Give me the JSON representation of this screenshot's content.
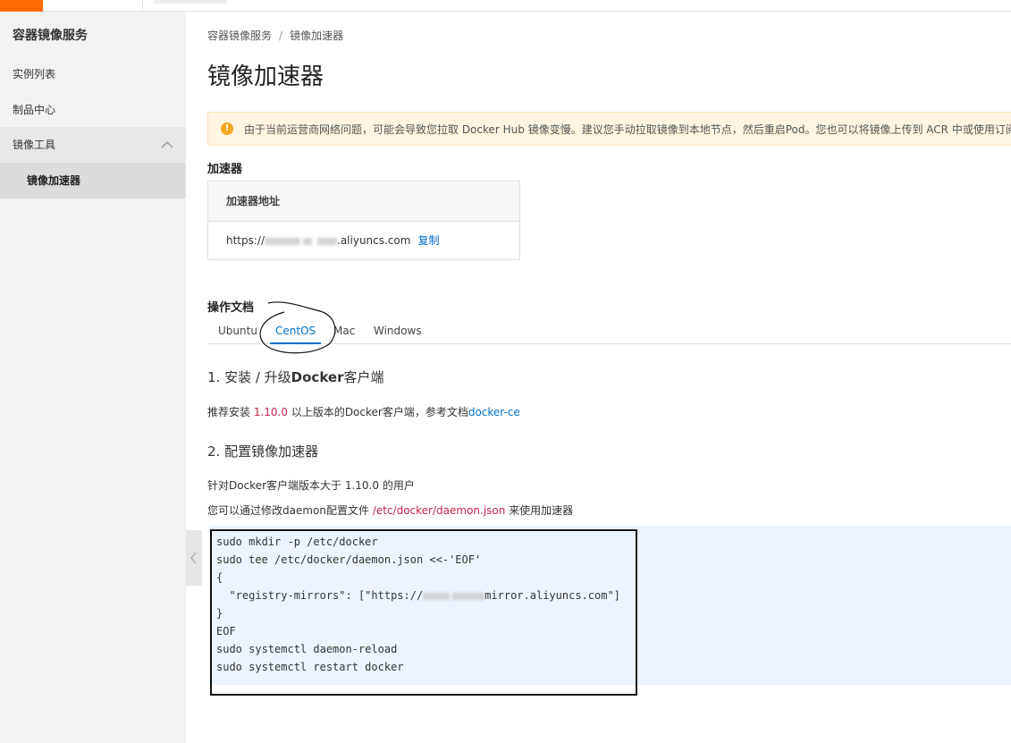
{
  "sidebar": {
    "title": "容器镜像服务",
    "items": [
      {
        "label": "实例列表"
      },
      {
        "label": "制品中心"
      },
      {
        "label": "镜像工具"
      },
      {
        "label": "镜像加速器"
      }
    ]
  },
  "breadcrumb": {
    "root": "容器镜像服务",
    "sep": "/",
    "current": "镜像加速器"
  },
  "page_title": "镜像加速器",
  "alert": {
    "message": "由于当前运营商网络问题，可能会导致您拉取 Docker Hub 镜像变慢。建议您手动拉取镜像到本地节点，然后重启Pod。您也可以将镜像上传到 ACR 中或使用订阅海"
  },
  "accelerator": {
    "section_title": "加速器",
    "column_header": "加速器地址",
    "url_prefix": "https://",
    "url_suffix": ".aliyuncs.com",
    "copy_label": "复制"
  },
  "docs": {
    "section_title": "操作文档",
    "tabs": [
      {
        "label": "Ubuntu"
      },
      {
        "label": "CentOS"
      },
      {
        "label": "Mac"
      },
      {
        "label": "Windows"
      }
    ],
    "active_tab": "CentOS",
    "step1": {
      "prefix": "1. 安装 / 升级",
      "bold": "Docker",
      "suffix": "客户端",
      "text_before": "推荐安装 ",
      "version": "1.10.0",
      "text_middle": " 以上版本的Docker客户端，参考文档",
      "link": "docker-ce"
    },
    "step2": {
      "title": "2. 配置镜像加速器",
      "line1": "针对Docker客户端版本大于 1.10.0 的用户",
      "line2_before": "您可以通过修改daemon配置文件 ",
      "line2_path": "/etc/docker/daemon.json",
      "line2_after": " 来使用加速器"
    },
    "code": [
      "sudo mkdir -p /etc/docker",
      "sudo tee /etc/docker/daemon.json <<-'EOF'",
      "{",
      "  \"registry-mirrors\": [\"https://",
      "mirror.aliyuncs.com\"]",
      "}",
      "EOF",
      "sudo systemctl daemon-reload",
      "sudo systemctl restart docker"
    ]
  },
  "colors": {
    "brand": "#ff6a00",
    "link": "#0070cc",
    "alert_bg": "#fff5e0",
    "code_bg": "#ecf5fd"
  }
}
